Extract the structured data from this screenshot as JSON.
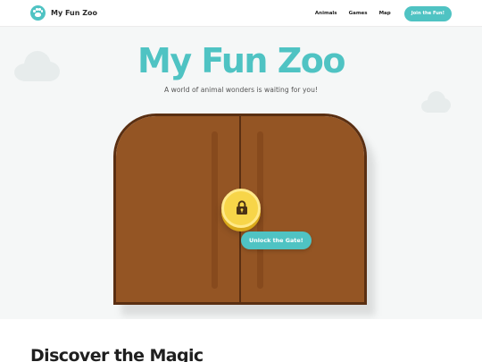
{
  "header": {
    "brand_name": "My Fun Zoo",
    "brand_icon": "paw-icon",
    "nav": [
      "Animals",
      "Games",
      "Map"
    ],
    "cta_label": "Join the Fun!"
  },
  "hero": {
    "title": "My Fun Zoo",
    "subtitle": "A world of animal wonders is waiting for you!",
    "gate": {
      "lock_icon": "lock-icon",
      "unlock_label": "Unlock the Gate!"
    }
  },
  "section": {
    "title": "Discover the Magic"
  },
  "colors": {
    "accent": "#4fc3c3",
    "gate_wood": "#945524",
    "gate_border": "#5a2f12",
    "lock_gold": "#f7d549",
    "hero_bg": "#f5f7f7"
  }
}
